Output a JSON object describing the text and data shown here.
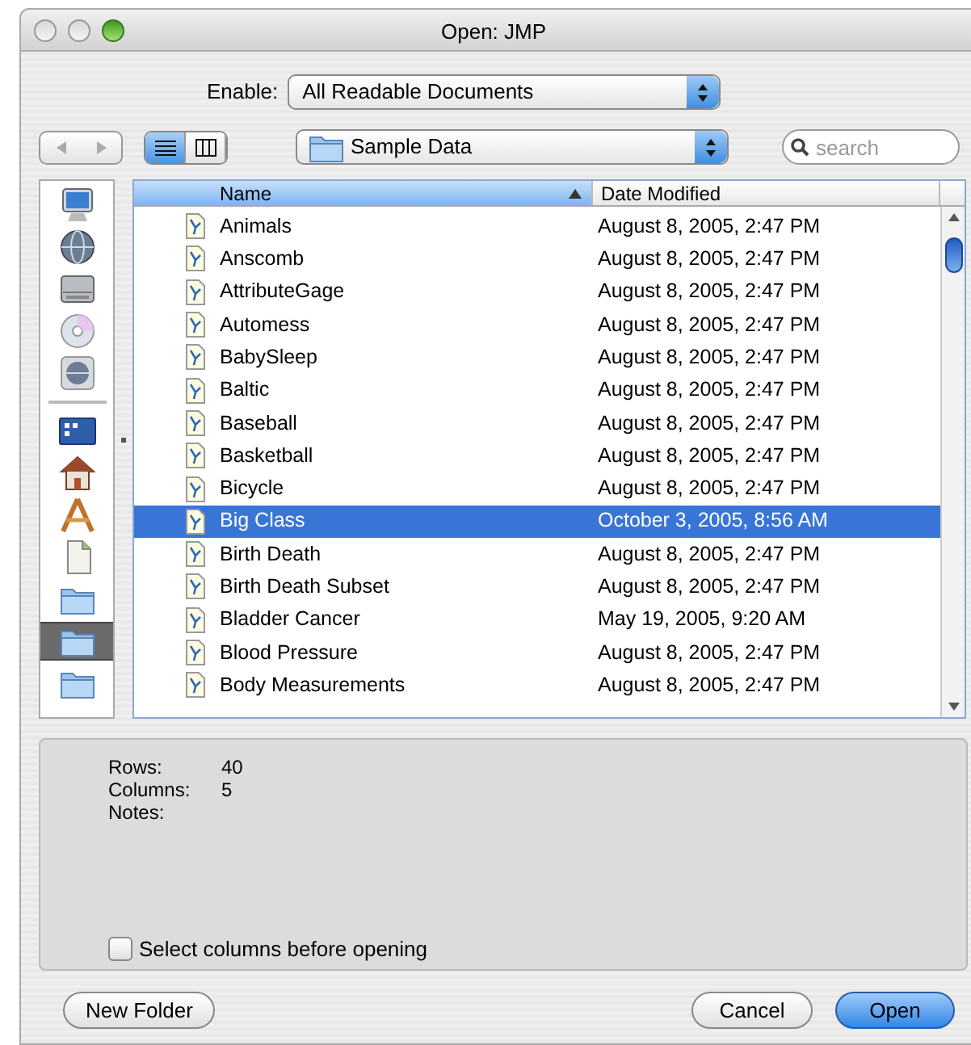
{
  "window": {
    "title": "Open: JMP"
  },
  "enable": {
    "label": "Enable:",
    "value": "All Readable Documents"
  },
  "view_modes": [
    {
      "kind": "list",
      "selected": true
    },
    {
      "kind": "columns",
      "selected": false
    }
  ],
  "location": {
    "value": "Sample Data"
  },
  "search": {
    "placeholder": "search"
  },
  "sidebar": {
    "items": [
      {
        "kind": "computer",
        "selected": false
      },
      {
        "kind": "network",
        "selected": false
      },
      {
        "kind": "disk",
        "selected": false
      },
      {
        "kind": "cd",
        "selected": false
      },
      {
        "kind": "idisk",
        "selected": false
      },
      {
        "kind": "separator",
        "selected": false
      },
      {
        "kind": "desktop",
        "selected": false
      },
      {
        "kind": "home",
        "selected": false
      },
      {
        "kind": "applications",
        "selected": false
      },
      {
        "kind": "document",
        "selected": false
      },
      {
        "kind": "folder",
        "selected": false
      },
      {
        "kind": "folder",
        "selected": true
      },
      {
        "kind": "folder",
        "selected": false
      }
    ]
  },
  "table": {
    "columns": [
      {
        "label": "Name",
        "sorted": true
      },
      {
        "label": "Date Modified",
        "sorted": false
      }
    ],
    "rows": [
      {
        "name": "Animals",
        "date": "August 8, 2005, 2:47 PM",
        "selected": false
      },
      {
        "name": "Anscomb",
        "date": "August 8, 2005, 2:47 PM",
        "selected": false
      },
      {
        "name": "AttributeGage",
        "date": "August 8, 2005, 2:47 PM",
        "selected": false
      },
      {
        "name": "Automess",
        "date": "August 8, 2005, 2:47 PM",
        "selected": false
      },
      {
        "name": "BabySleep",
        "date": "August 8, 2005, 2:47 PM",
        "selected": false
      },
      {
        "name": "Baltic",
        "date": "August 8, 2005, 2:47 PM",
        "selected": false
      },
      {
        "name": "Baseball",
        "date": "August 8, 2005, 2:47 PM",
        "selected": false
      },
      {
        "name": "Basketball",
        "date": "August 8, 2005, 2:47 PM",
        "selected": false
      },
      {
        "name": "Bicycle",
        "date": "August 8, 2005, 2:47 PM",
        "selected": false
      },
      {
        "name": "Big Class",
        "date": "October 3, 2005, 8:56 AM",
        "selected": true
      },
      {
        "name": "Birth Death",
        "date": "August 8, 2005, 2:47 PM",
        "selected": false
      },
      {
        "name": "Birth Death Subset",
        "date": "August 8, 2005, 2:47 PM",
        "selected": false
      },
      {
        "name": "Bladder Cancer",
        "date": "May 19, 2005, 9:20 AM",
        "selected": false
      },
      {
        "name": "Blood Pressure",
        "date": "August 8, 2005, 2:47 PM",
        "selected": false
      },
      {
        "name": "Body Measurements",
        "date": "August 8, 2005, 2:47 PM",
        "selected": false
      }
    ]
  },
  "info": [
    {
      "label": "Rows:",
      "value": "40"
    },
    {
      "label": "Columns:",
      "value": "5"
    },
    {
      "label": "Notes:"
    }
  ],
  "checkbox": {
    "label": "Select columns before opening",
    "checked": false
  },
  "buttons": [
    {
      "label": "New Folder",
      "default": false
    },
    {
      "label": "Cancel",
      "default": false
    },
    {
      "label": "Open",
      "default": true
    }
  ]
}
